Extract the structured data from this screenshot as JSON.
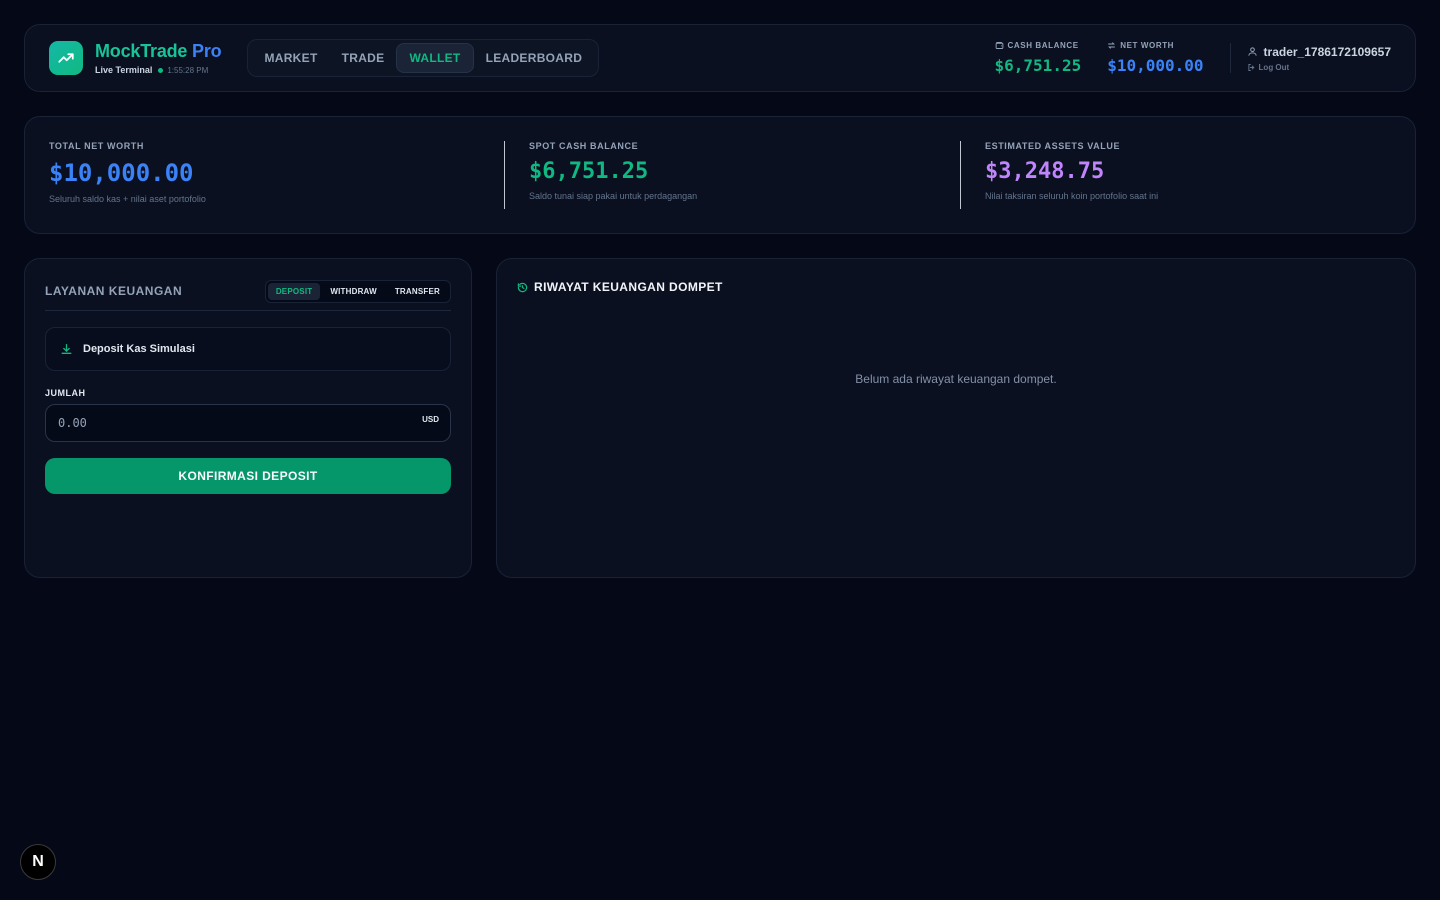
{
  "colors": {
    "accent_green": "#10b981",
    "accent_blue": "#3b82f6",
    "accent_purple": "#c084fc",
    "background": "#050816",
    "panel": "#0a1020"
  },
  "header": {
    "brand_name": "MockTrade",
    "brand_suffix": "Pro",
    "status_label": "Live Terminal",
    "clock": "1:55:28 PM",
    "logo_icon": "trending-up-icon",
    "nav": [
      {
        "label": "MARKET",
        "active": false
      },
      {
        "label": "TRADE",
        "active": false
      },
      {
        "label": "WALLET",
        "active": true
      },
      {
        "label": "LEADERBOARD",
        "active": false
      }
    ],
    "cash_balance_label": "CASH BALANCE",
    "cash_balance_value": "$6,751.25",
    "net_worth_label": "NET WORTH",
    "net_worth_value": "$10,000.00",
    "username": "trader_1786172109657",
    "logout_label": "Log Out"
  },
  "summary": {
    "total_net_worth": {
      "label": "TOTAL NET WORTH",
      "value": "$10,000.00",
      "desc": "Seluruh saldo kas + nilai aset portofolio"
    },
    "spot_cash": {
      "label": "SPOT CASH BALANCE",
      "value": "$6,751.25",
      "desc": "Saldo tunai siap pakai untuk perdagangan"
    },
    "assets_value": {
      "label": "ESTIMATED ASSETS VALUE",
      "value": "$3,248.75",
      "desc": "Nilai taksiran seluruh koin portofolio saat ini"
    }
  },
  "service": {
    "title": "LAYANAN KEUANGAN",
    "tabs": [
      {
        "label": "DEPOSIT",
        "active": true
      },
      {
        "label": "WITHDRAW",
        "active": false
      },
      {
        "label": "TRANSFER",
        "active": false
      }
    ],
    "mode_label": "Deposit Kas Simulasi",
    "amount_label": "JUMLAH",
    "amount_placeholder": "0.00",
    "amount_unit": "USD",
    "confirm_label": "KONFIRMASI DEPOSIT"
  },
  "history": {
    "title": "RIWAYAT KEUANGAN DOMPET",
    "empty_text": "Belum ada riwayat keuangan dompet."
  },
  "badge": {
    "label": "N"
  }
}
